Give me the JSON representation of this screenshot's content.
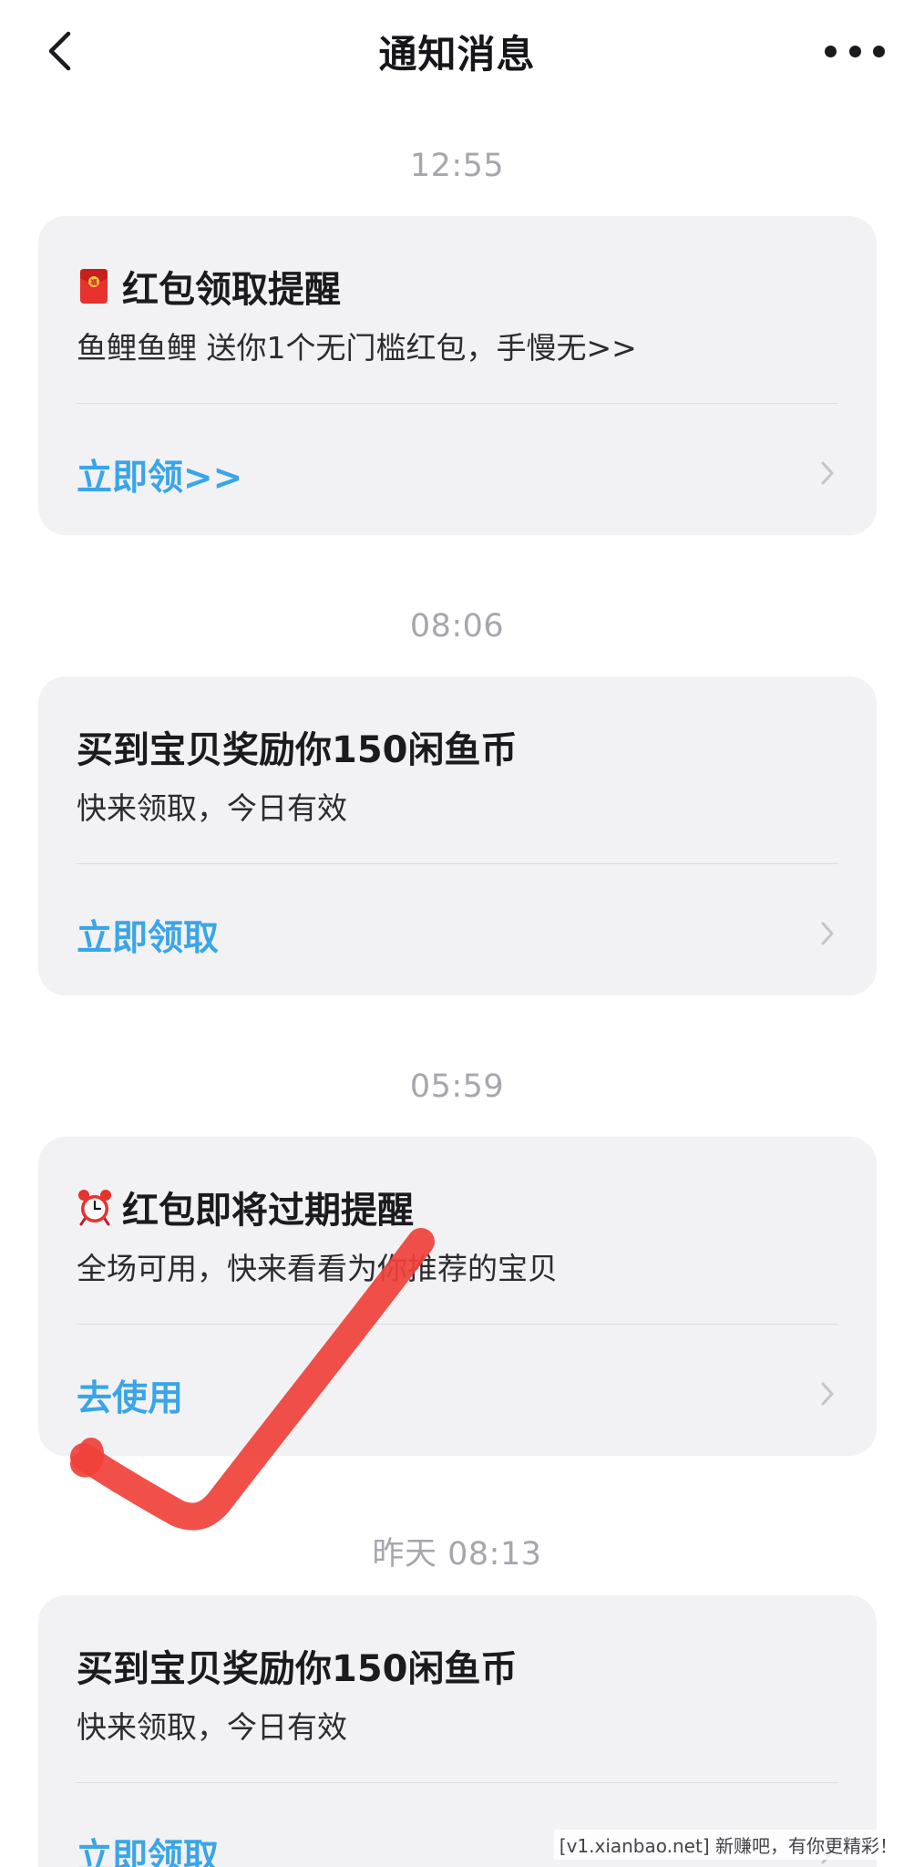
{
  "header": {
    "title": "通知消息"
  },
  "messages": [
    {
      "time": "12:55",
      "icon": "red-envelope-icon",
      "title": "红包领取提醒",
      "subtitle": "鱼鲤鱼鲤 送你1个无门槛红包，手慢无>>",
      "action": "立即领>>"
    },
    {
      "time": "08:06",
      "icon": "",
      "title": "买到宝贝奖励你150闲鱼币",
      "subtitle": "快来领取，今日有效",
      "action": "立即领取"
    },
    {
      "time": "05:59",
      "icon": "alarm-clock-icon",
      "title": "红包即将过期提醒",
      "subtitle": "全场可用，快来看看为你推荐的宝贝",
      "action": "去使用"
    },
    {
      "time": "昨天 08:13",
      "icon": "",
      "title": "买到宝贝奖励你150闲鱼币",
      "subtitle": "快来领取，今日有效",
      "action": "立即领取"
    }
  ],
  "colors": {
    "accent": "#3aa5e8",
    "card_bg": "#f2f2f4",
    "timestamp": "#a6a6ad",
    "check_mark": "#f0413a"
  },
  "watermark": "[v1.xianbao.net] 新赚吧，有你更精彩！"
}
